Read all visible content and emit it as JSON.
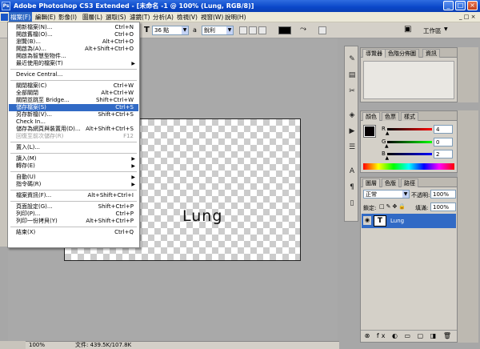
{
  "window": {
    "title": "Adobe Photoshop CS3 Extended - [未命名 -1 @ 100% (Lung, RGB/8)]"
  },
  "menubar": [
    {
      "label": "檔案(F)",
      "active": true
    },
    {
      "label": "編輯(E)"
    },
    {
      "label": "影像(I)"
    },
    {
      "label": "圖層(L)"
    },
    {
      "label": "選取(S)"
    },
    {
      "label": "濾鏡(T)"
    },
    {
      "label": "分析(A)"
    },
    {
      "label": "檢視(V)"
    },
    {
      "label": "視窗(W)"
    },
    {
      "label": "說明(H)"
    }
  ],
  "options": {
    "font_size": "36 點",
    "antialias_icon": "a",
    "antialias": "銳利",
    "workspace": "工作區"
  },
  "file_menu": [
    {
      "label": "開新檔案(N)...",
      "shortcut": "Ctrl+N"
    },
    {
      "label": "開啟舊檔(O)...",
      "shortcut": "Ctrl+O"
    },
    {
      "label": "瀏覽(B)...",
      "shortcut": "Alt+Ctrl+O"
    },
    {
      "label": "開啟為(A)...",
      "shortcut": "Alt+Shift+Ctrl+O"
    },
    {
      "label": "開啟為智慧型物件...",
      "shortcut": ""
    },
    {
      "label": "最近使用的檔案(T)",
      "shortcut": "",
      "submenu": true
    },
    {
      "sep": true
    },
    {
      "label": "Device Central...",
      "shortcut": ""
    },
    {
      "sep": true
    },
    {
      "label": "關閉檔案(C)",
      "shortcut": "Ctrl+W"
    },
    {
      "label": "全部關閉",
      "shortcut": "Alt+Ctrl+W"
    },
    {
      "label": "關閉並跳至 Bridge...",
      "shortcut": "Shift+Ctrl+W"
    },
    {
      "label": "儲存檔案(S)",
      "shortcut": "Ctrl+S",
      "highlight": true
    },
    {
      "label": "另存新檔(V)...",
      "shortcut": "Shift+Ctrl+S"
    },
    {
      "label": "Check In...",
      "shortcut": ""
    },
    {
      "label": "儲存為網頁與裝置用(D)...",
      "shortcut": "Alt+Shift+Ctrl+S"
    },
    {
      "label": "回復至前次儲存(R)",
      "shortcut": "F12",
      "disabled": true
    },
    {
      "sep": true
    },
    {
      "label": "置入(L)...",
      "shortcut": ""
    },
    {
      "sep": true
    },
    {
      "label": "讀入(M)",
      "shortcut": "",
      "submenu": true
    },
    {
      "label": "轉存(E)",
      "shortcut": "",
      "submenu": true
    },
    {
      "sep": true
    },
    {
      "label": "自動(U)",
      "shortcut": "",
      "submenu": true
    },
    {
      "label": "指令碼(R)",
      "shortcut": "",
      "submenu": true
    },
    {
      "sep": true
    },
    {
      "label": "檔案資訊(F)...",
      "shortcut": "Alt+Shift+Ctrl+I"
    },
    {
      "sep": true
    },
    {
      "label": "頁面設定(G)...",
      "shortcut": "Shift+Ctrl+P"
    },
    {
      "label": "列印(P)...",
      "shortcut": "Ctrl+P"
    },
    {
      "label": "列印一份拷貝(Y)",
      "shortcut": "Alt+Shift+Ctrl+P"
    },
    {
      "sep": true
    },
    {
      "label": "結束(X)",
      "shortcut": "Ctrl+Q"
    }
  ],
  "canvas": {
    "text": "Lung"
  },
  "status": {
    "zoom": "100%",
    "doc": "文件: 439.5K/107.8K"
  },
  "navigator_tabs": [
    "導覽器",
    "色階分佈圖",
    "資訊"
  ],
  "color_tabs": [
    "顏色",
    "色票",
    "樣式"
  ],
  "color": {
    "r_label": "R",
    "r_value": "4",
    "g_label": "G",
    "g_value": "0",
    "b_label": "B",
    "b_value": "2",
    "r_level": 0.016,
    "g_level": 0.0,
    "b_level": 0.008
  },
  "layers_tabs": [
    "圖層",
    "色版",
    "路徑"
  ],
  "layers": {
    "blend_mode": "正常",
    "opacity_label": "不透明:",
    "opacity": "100%",
    "lock_label": "鎖定:",
    "fill_label": "填滿:",
    "fill": "100%",
    "items": [
      {
        "type_icon": "T",
        "name": "Lung"
      }
    ]
  },
  "icons": {
    "title_icon": "photoshop-icon",
    "eye": "eye-icon",
    "type_layer": "type-layer-icon"
  },
  "accent": "#316ac5"
}
